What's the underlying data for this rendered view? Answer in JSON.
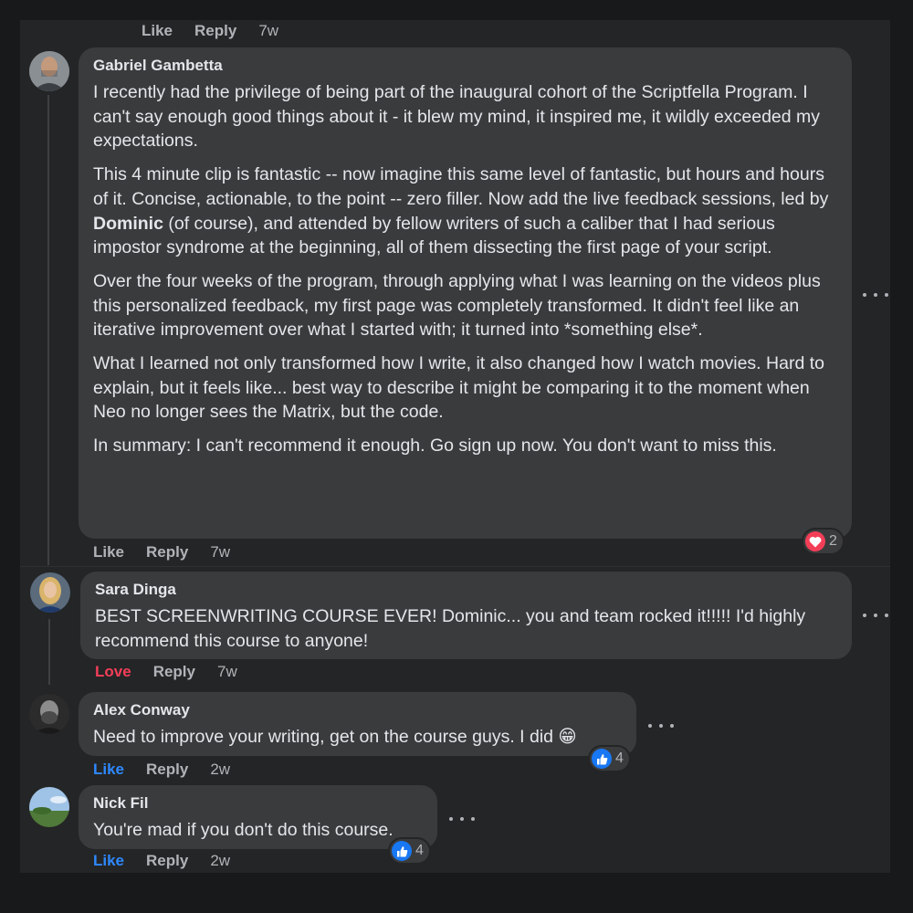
{
  "top_actions": {
    "like": "Like",
    "reply": "Reply",
    "time": "7w"
  },
  "comments": [
    {
      "author": "Gabriel Gambetta",
      "paragraphs": [
        "I recently had the privilege of being part of the inaugural cohort of the Scriptfella Program. I can't say enough good things about it - it blew my mind, it inspired me, it wildly exceeded my expectations."
      ],
      "p2_before": "This 4 minute clip is fantastic -- now imagine this same level of fantastic, but hours and hours of it. Concise, actionable, to the point -- zero filler. Now add the live feedback sessions, led by ",
      "p2_mention": "Dominic",
      "p2_after": " (of course), and attended by fellow writers of such a caliber that I had serious impostor syndrome at the beginning, all of them dissecting the first page of your script.",
      "p3": "Over the four weeks of the program, through applying what I was learning on the videos plus this personalized feedback, my first page was completely transformed. It didn't feel like an iterative improvement over what I started with; it turned into *something else*.",
      "p4": "What I learned not only transformed how I write, it also changed how I watch movies. Hard to explain, but it feels like... best way to describe it might be comparing it to the moment when Neo no longer sees the Matrix, but the code.",
      "p5": "In summary: I can't recommend it enough. Go sign up now. You don't want to miss this.",
      "reaction": {
        "icon": "heart-icon",
        "count": "2",
        "color": "#f33e58"
      },
      "like": "Like",
      "reply": "Reply",
      "time": "7w"
    },
    {
      "author": "Sara Dinga",
      "text": "BEST SCREENWRITING COURSE EVER! Dominic... you and team rocked it!!!!! I'd highly recommend this course to anyone!",
      "like": "Love",
      "reply": "Reply",
      "time": "7w"
    },
    {
      "author": "Alex Conway",
      "text": "Need to improve your writing, get on the course guys. I did 😁",
      "reaction": {
        "icon": "thumbs-up-icon",
        "count": "4",
        "color": "#1877f2"
      },
      "like": "Like",
      "reply": "Reply",
      "time": "2w"
    },
    {
      "author": "Nick Fil",
      "text": "You're mad if you don't do this course.",
      "reaction": {
        "icon": "thumbs-up-icon",
        "count": "4",
        "color": "#1877f2"
      },
      "like": "Like",
      "reply": "Reply",
      "time": "2w"
    }
  ]
}
